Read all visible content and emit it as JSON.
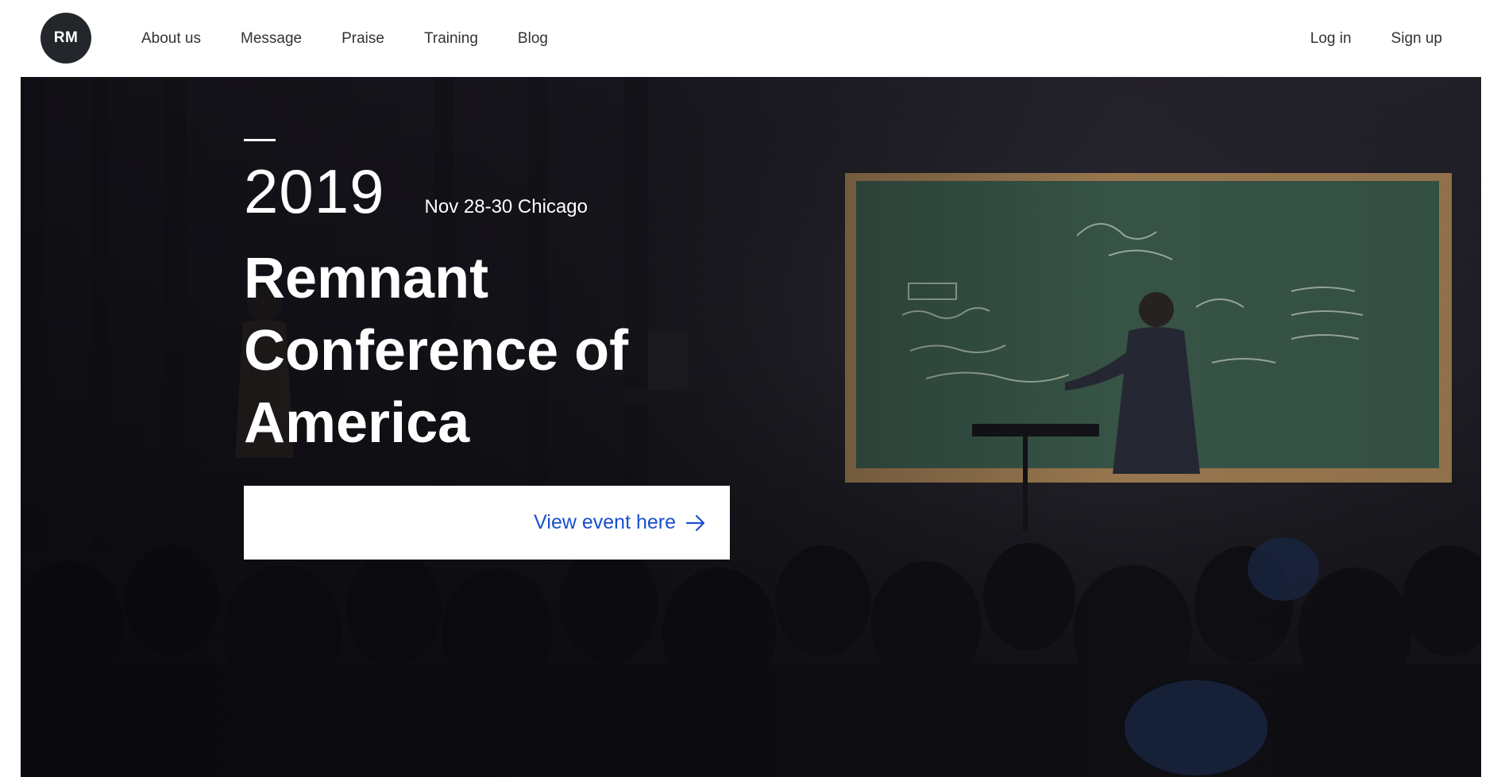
{
  "header": {
    "logo_text": "RM",
    "nav_left": [
      "About us",
      "Message",
      "Praise",
      "Training",
      "Blog"
    ],
    "nav_right": [
      "Log in",
      "Sign up"
    ]
  },
  "hero": {
    "year": "2019",
    "date_location": "Nov 28-30 Chicago",
    "title": "Remnant Conference of America",
    "cta_label": "View event here",
    "cta_icon": "arrow-right-icon",
    "colors": {
      "cta_text": "#1a4ecf",
      "logo_bg": "#23272b",
      "board": "#3f6150"
    }
  }
}
